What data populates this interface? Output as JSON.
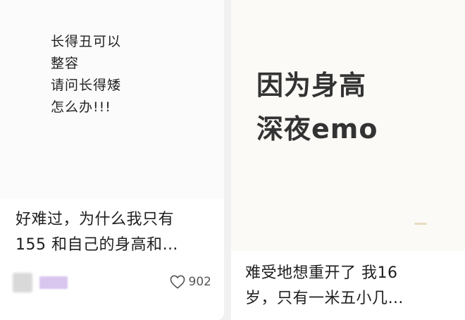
{
  "cards": [
    {
      "cover_lines": [
        "长得丑可以",
        "整容",
        "请问长得矮",
        "怎么办!!!"
      ],
      "title_line1": "好难过，为什么我只有",
      "title_line2": "155 和自己的身高和…",
      "likes": "902",
      "icons": {
        "like": "heart-outline-icon"
      }
    },
    {
      "cover_lines": [
        "因为身高",
        "深夜emo"
      ],
      "title_line1": "难受地想重开了 我16",
      "title_line2": "岁，只有一米五小几…"
    }
  ]
}
